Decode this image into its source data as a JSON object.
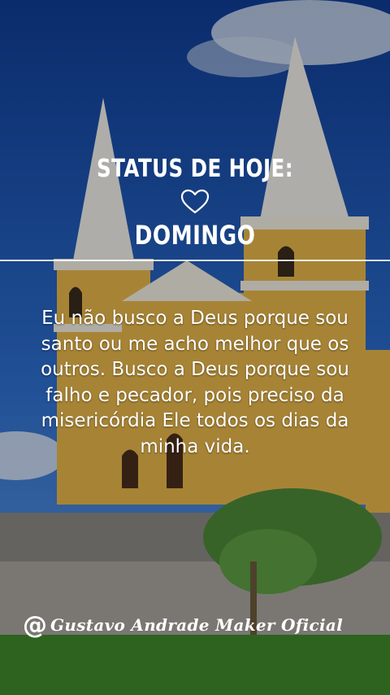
{
  "header": {
    "status_title": "STATUS DE HOJE:",
    "heart_icon": "heart-outline-icon",
    "day": "DOMINGO"
  },
  "quote": {
    "text": "Eu não busco a Deus porque sou santo ou me acho melhor que os outros. Busco a Deus porque sou falho e pecador, pois preciso da misericórdia Ele todos os dias da minha vida."
  },
  "signature": {
    "at_symbol": "@",
    "name": "Gustavo Andrade Maker Oficial"
  },
  "colors": {
    "sky": "#1b4fa8",
    "church_wall": "#e8b84a",
    "church_trim": "#f3efe4",
    "grass": "#3f8a2c"
  }
}
